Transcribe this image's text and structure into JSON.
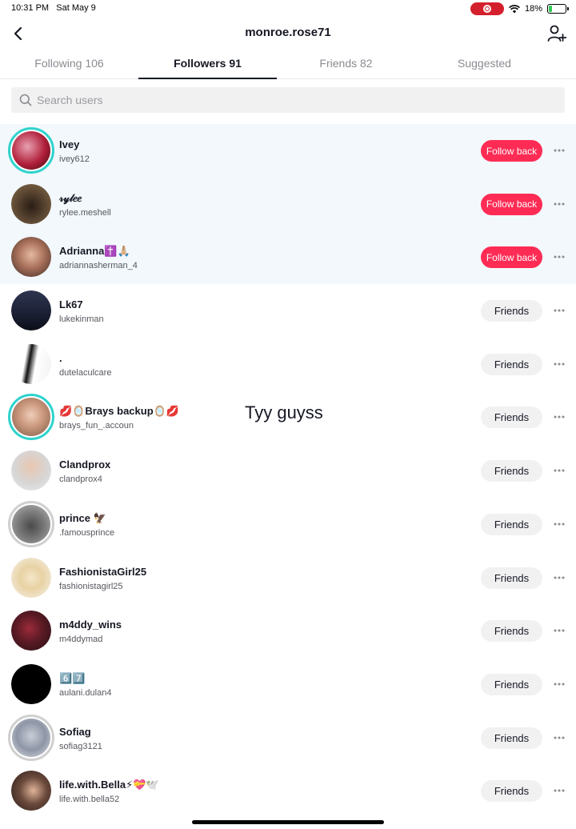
{
  "status": {
    "time": "10:31 PM",
    "date": "Sat May 9",
    "battery": "18%",
    "battery_level": 0.18
  },
  "header": {
    "title": "monroe.rose71"
  },
  "tabs": [
    {
      "label": "Following 106"
    },
    {
      "label": "Followers 91"
    },
    {
      "label": "Friends 82"
    },
    {
      "label": "Suggested"
    }
  ],
  "search": {
    "placeholder": "Search users",
    "value": ""
  },
  "overlay": {
    "text": "Tyy guyss"
  },
  "users": [
    {
      "name": "Ivey",
      "handle": "ivey612",
      "button": "Follow back"
    },
    {
      "name": "𝓇𝓎𝓁𝑒𝑒",
      "handle": "rylee.meshell",
      "button": "Follow back"
    },
    {
      "name": "Adrianna✝️🙏🏼",
      "handle": "adriannasherman_4",
      "button": "Follow back"
    },
    {
      "name": "Lk67",
      "handle": "lukekinman",
      "button": "Friends"
    },
    {
      "name": ".",
      "handle": "dutelaculcare",
      "button": "Friends"
    },
    {
      "name": "💋🪞Brays backup🪞💋",
      "handle": "brays_fun_.accoun",
      "button": "Friends"
    },
    {
      "name": "Clandprox",
      "handle": "clandprox4",
      "button": "Friends"
    },
    {
      "name": "prince 🦅",
      "handle": ".famousprince",
      "button": "Friends"
    },
    {
      "name": "FashionistaGirl25",
      "handle": "fashionistagirl25",
      "button": "Friends"
    },
    {
      "name": "m4ddy_wins",
      "handle": "m4ddymad",
      "button": "Friends"
    },
    {
      "name": "6️⃣7️⃣",
      "handle": "aulani.dulan4",
      "button": "Friends"
    },
    {
      "name": "Sofiag",
      "handle": "sofiag3121",
      "button": "Friends"
    },
    {
      "name": "life.with.Bella⚡💝🕊️",
      "handle": "life.with.bella52",
      "button": "Friends"
    }
  ],
  "colors": {
    "accent": "#fe2c55",
    "ring": "#2fd3cd",
    "highlight_row": "#f2f8fc"
  }
}
